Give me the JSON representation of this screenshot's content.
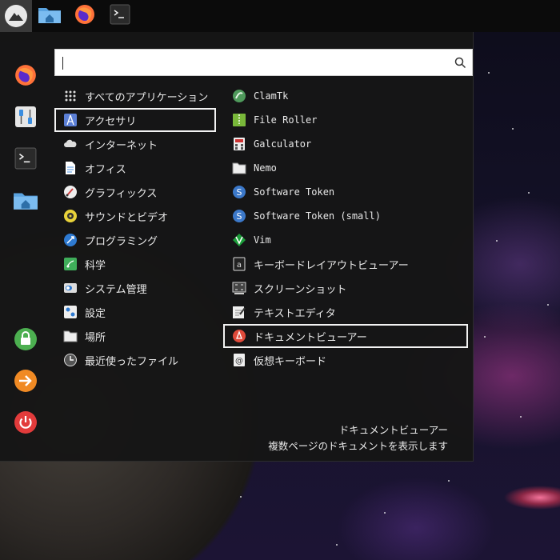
{
  "taskbar": {
    "launchers": [
      {
        "name": "home-folder"
      },
      {
        "name": "firefox"
      },
      {
        "name": "terminal"
      }
    ]
  },
  "favorites": [
    {
      "icon": "firefox-icon"
    },
    {
      "icon": "settings-icon"
    },
    {
      "icon": "terminal-icon"
    },
    {
      "icon": "home-folder-icon"
    },
    {
      "icon": "lock-icon"
    },
    {
      "icon": "logout-icon"
    },
    {
      "icon": "power-icon"
    }
  ],
  "search": {
    "value": "",
    "placeholder": ""
  },
  "categories": [
    {
      "label": "すべてのアプリケーション",
      "icon": "grid-icon",
      "selected": false
    },
    {
      "label": "アクセサリ",
      "icon": "accessories-icon",
      "selected": true
    },
    {
      "label": "インターネット",
      "icon": "cloud-icon",
      "selected": false
    },
    {
      "label": "オフィス",
      "icon": "document-icon",
      "selected": false
    },
    {
      "label": "グラフィックス",
      "icon": "graphics-icon",
      "selected": false
    },
    {
      "label": "サウンドとビデオ",
      "icon": "media-icon",
      "selected": false
    },
    {
      "label": "プログラミング",
      "icon": "programming-icon",
      "selected": false
    },
    {
      "label": "科学",
      "icon": "science-icon",
      "selected": false
    },
    {
      "label": "システム管理",
      "icon": "system-icon",
      "selected": false
    },
    {
      "label": "設定",
      "icon": "preferences-icon",
      "selected": false
    },
    {
      "label": "場所",
      "icon": "folder-icon",
      "selected": false
    },
    {
      "label": "最近使ったファイル",
      "icon": "clock-icon",
      "selected": false
    }
  ],
  "apps": [
    {
      "label": "ClamTk",
      "icon": "clamtk-icon",
      "mono": true,
      "selected": false
    },
    {
      "label": "File Roller",
      "icon": "archive-icon",
      "mono": true,
      "selected": false
    },
    {
      "label": "Galculator",
      "icon": "calculator-icon",
      "mono": true,
      "selected": false
    },
    {
      "label": "Nemo",
      "icon": "folder-icon",
      "mono": true,
      "selected": false
    },
    {
      "label": "Software Token",
      "icon": "token-icon",
      "mono": true,
      "selected": false
    },
    {
      "label": "Software Token (small)",
      "icon": "token-icon",
      "mono": true,
      "selected": false
    },
    {
      "label": "Vim",
      "icon": "vim-icon",
      "mono": true,
      "selected": false
    },
    {
      "label": "キーボードレイアウトビューアー",
      "icon": "keyboard-layout-icon",
      "mono": false,
      "selected": false
    },
    {
      "label": "スクリーンショット",
      "icon": "screenshot-icon",
      "mono": false,
      "selected": false
    },
    {
      "label": "テキストエディタ",
      "icon": "text-editor-icon",
      "mono": false,
      "selected": false
    },
    {
      "label": "ドキュメントビューアー",
      "icon": "pdf-icon",
      "mono": false,
      "selected": true
    },
    {
      "label": "仮想キーボード",
      "icon": "onscreen-keyboard-icon",
      "mono": false,
      "selected": false
    }
  ],
  "description": {
    "title": "ドキュメントビューアー",
    "text": "複数ページのドキュメントを表示します"
  }
}
